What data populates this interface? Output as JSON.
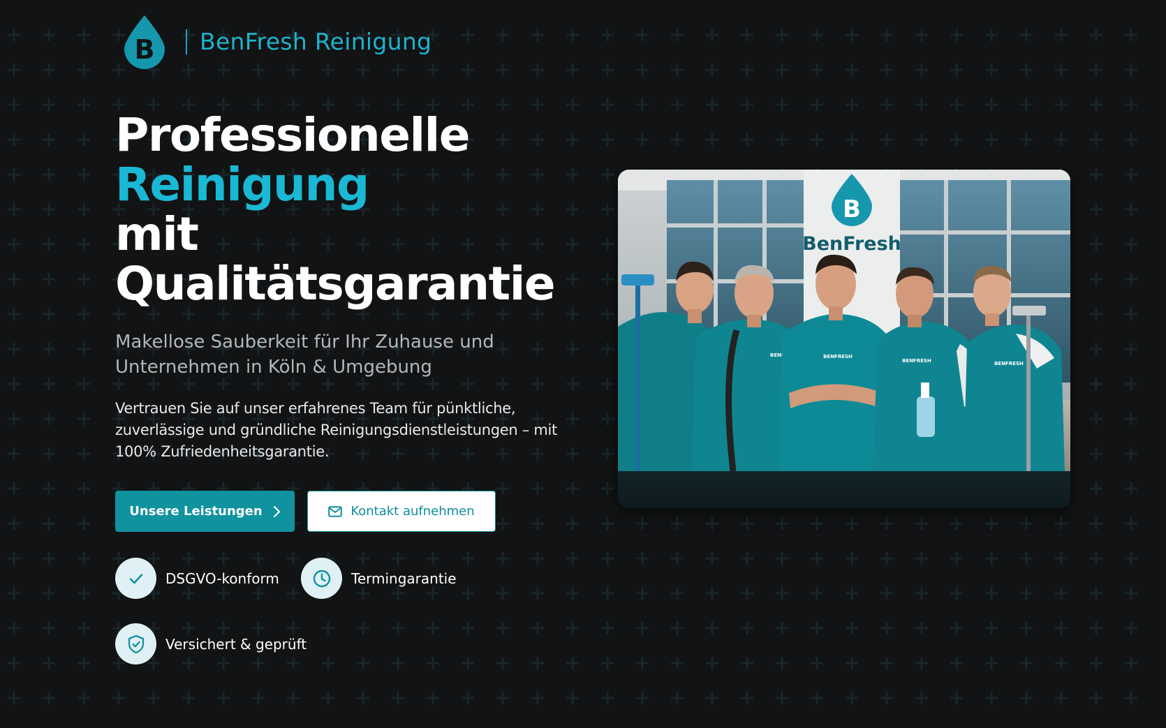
{
  "brand": {
    "logo_letter": "B",
    "name": "BenFresh Reinigung",
    "accent_color": "#1ab8d4",
    "button_color": "#10929f"
  },
  "hero": {
    "headline_line1": "Professionelle",
    "headline_line2": "Reinigung",
    "headline_line3": "mit",
    "headline_line4": "Qualitätsgarantie",
    "subtitle": "Makellose Sauberkeit für Ihr Zuhause und Unternehmen in Köln & Umgebung",
    "body": "Vertrauen Sie auf unser erfahrenes Team für pünktliche, zuverlässige und gründliche Reinigungsdienstleistungen – mit 100% Zufriedenheitsgarantie."
  },
  "buttons": {
    "primary_label": "Unsere Leistungen",
    "primary_icon": "chevron-right-icon",
    "secondary_label": "Kontakt aufnehmen",
    "secondary_icon": "mail-icon"
  },
  "features": [
    {
      "label": "DSGVO-konform",
      "icon": "check-icon"
    },
    {
      "label": "Termingarantie",
      "icon": "clock-icon"
    },
    {
      "label": "Versichert & geprüft",
      "icon": "shield-check-icon"
    }
  ],
  "photo": {
    "sign_letter": "B",
    "sign_text": "BenFresh",
    "shirt_text": "BENFRESH"
  }
}
